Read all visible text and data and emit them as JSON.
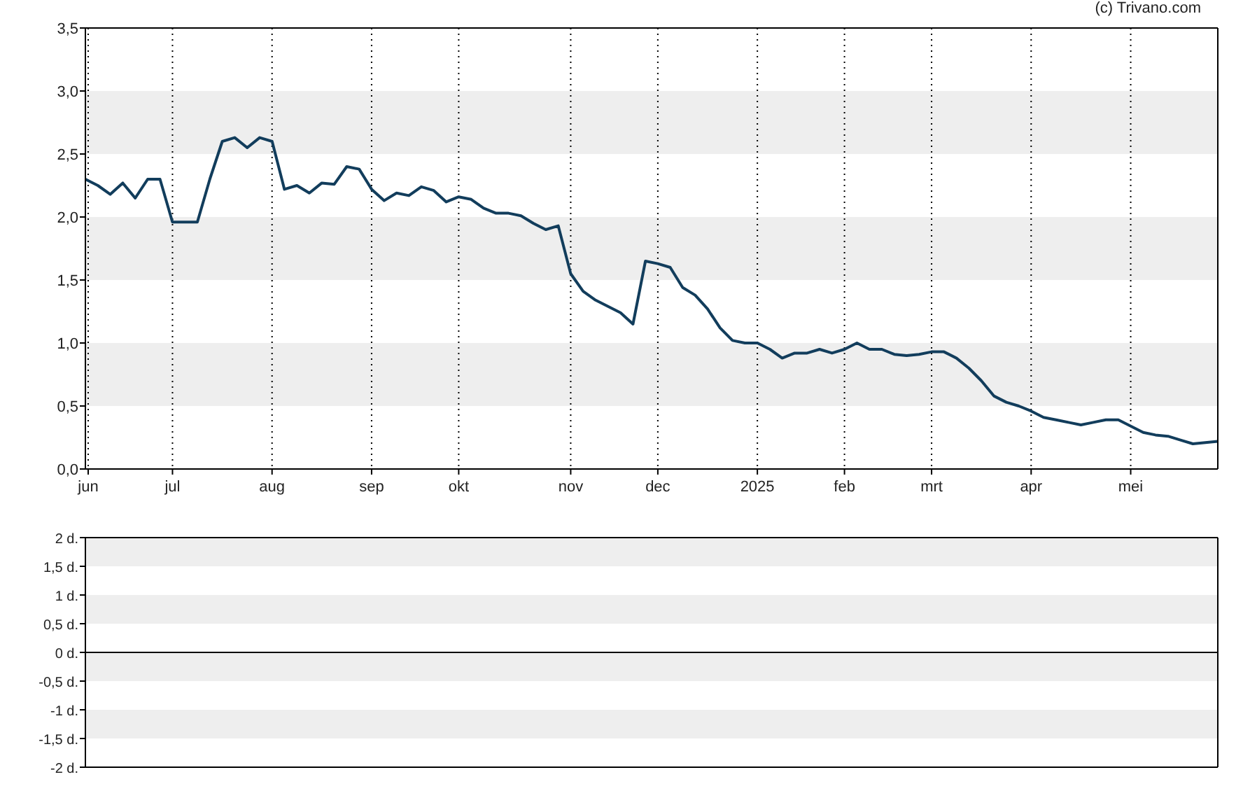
{
  "credit": "(c) Trivano.com",
  "price_chart": {
    "chart_data": {
      "type": "line",
      "grid": true,
      "ylim": [
        0,
        3.5
      ],
      "yticks": [
        {
          "value": 0,
          "label": "0,0"
        },
        {
          "value": 0.5,
          "label": "0,5"
        },
        {
          "value": 1,
          "label": "1,0"
        },
        {
          "value": 1.5,
          "label": "1,5"
        },
        {
          "value": 2,
          "label": "2,0"
        },
        {
          "value": 2.5,
          "label": "2,5"
        },
        {
          "value": 3,
          "label": "3,0"
        },
        {
          "value": 3.5,
          "label": "3,5"
        }
      ],
      "categories": [
        "jun",
        null,
        null,
        null,
        null,
        null,
        null,
        "jul",
        null,
        null,
        null,
        null,
        null,
        null,
        null,
        "aug",
        null,
        null,
        null,
        null,
        null,
        null,
        null,
        "sep",
        null,
        null,
        null,
        null,
        null,
        null,
        "okt",
        null,
        null,
        null,
        null,
        null,
        null,
        null,
        null,
        "nov",
        null,
        null,
        null,
        null,
        null,
        null,
        "dec",
        null,
        null,
        null,
        null,
        null,
        null,
        null,
        "2025",
        null,
        null,
        null,
        null,
        null,
        null,
        "feb",
        null,
        null,
        null,
        null,
        null,
        null,
        "mrt",
        null,
        null,
        null,
        null,
        null,
        null,
        null,
        "apr",
        null,
        null,
        null,
        null,
        null,
        null,
        null,
        "mei",
        null,
        null,
        null,
        null,
        null,
        null,
        null
      ],
      "series": [
        {
          "color": "#123d5c",
          "values": [
            2.3,
            2.25,
            2.18,
            2.27,
            2.15,
            2.3,
            2.3,
            1.96,
            1.96,
            1.96,
            2.3,
            2.6,
            2.63,
            2.55,
            2.63,
            2.6,
            2.22,
            2.25,
            2.19,
            2.27,
            2.26,
            2.4,
            2.38,
            2.22,
            2.13,
            2.19,
            2.17,
            2.24,
            2.21,
            2.12,
            2.16,
            2.14,
            2.07,
            2.03,
            2.03,
            2.01,
            1.95,
            1.9,
            1.93,
            1.55,
            1.41,
            1.34,
            1.29,
            1.24,
            1.15,
            1.65,
            1.63,
            1.6,
            1.44,
            1.38,
            1.27,
            1.12,
            1.02,
            1.0,
            1.0,
            0.95,
            0.88,
            0.92,
            0.92,
            0.95,
            0.92,
            0.95,
            1.0,
            0.95,
            0.95,
            0.91,
            0.9,
            0.91,
            0.93,
            0.93,
            0.88,
            0.8,
            0.7,
            0.58,
            0.53,
            0.5,
            0.46,
            0.41,
            0.39,
            0.37,
            0.35,
            0.37,
            0.39,
            0.39,
            0.34,
            0.29,
            0.27,
            0.26,
            0.23,
            0.2,
            0.21,
            0.22
          ]
        }
      ]
    }
  },
  "lower_panel": {
    "y_labels": [
      "2 d.",
      "1,5 d.",
      "1 d.",
      "0,5 d.",
      "0 d.",
      "-0,5 d.",
      "-1 d.",
      "-1,5 d.",
      "-2 d."
    ]
  }
}
